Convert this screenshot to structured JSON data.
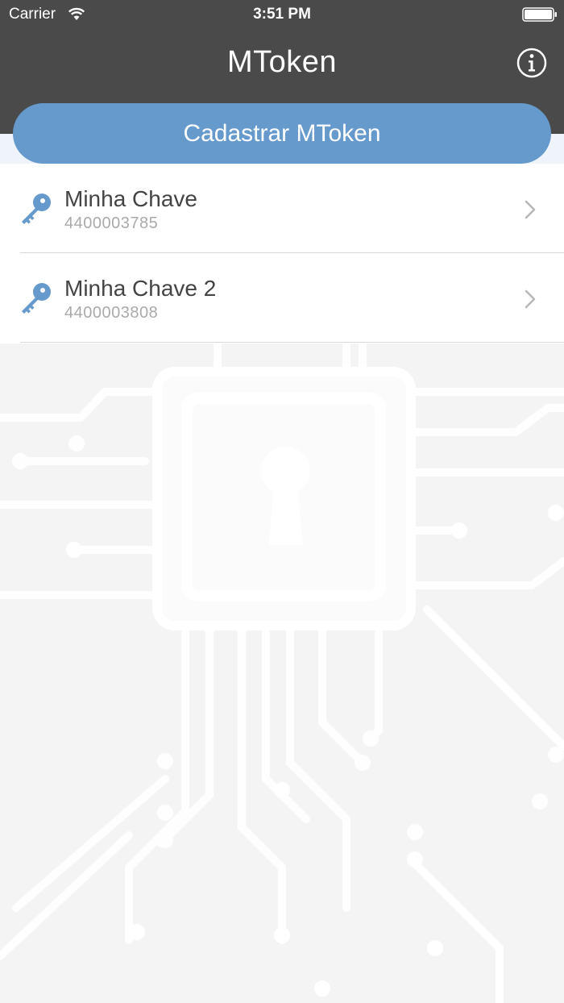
{
  "status_bar": {
    "carrier": "Carrier",
    "time": "3:51 PM",
    "wifi_icon": "wifi-icon",
    "battery_icon": "battery-full-icon"
  },
  "nav": {
    "title": "MToken",
    "info_icon": "info-icon"
  },
  "actions": {
    "register_label": "Cadastrar MToken"
  },
  "keys": [
    {
      "name": "Minha Chave",
      "serial": "4400003785",
      "icon": "key-icon",
      "accessory": "chevron-right-icon"
    },
    {
      "name": "Minha Chave 2",
      "serial": "4400003808",
      "icon": "key-icon",
      "accessory": "chevron-right-icon"
    }
  ],
  "background": {
    "illustration": "circuit-lock-chip-illustration"
  },
  "colors": {
    "header": "#4a4a4a",
    "accent": "#6699cc",
    "list_background": "#ffffff",
    "page_background": "#f4f4f4"
  }
}
